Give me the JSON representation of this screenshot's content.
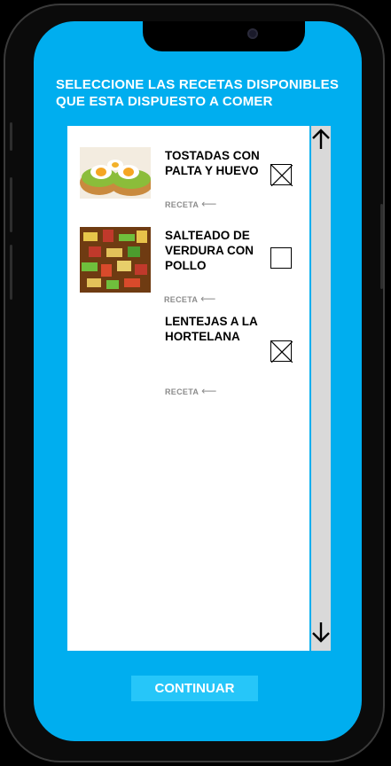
{
  "screen": {
    "heading": "SELECCIONE LAS RECETAS DISPONIBLES QUE ESTA DISPUESTO A COMER"
  },
  "recipes": [
    {
      "title": "TOSTADAS CON PALTA Y HUEVO",
      "link_label": "RECETA",
      "checked": true,
      "image": "avocado-egg-toast"
    },
    {
      "title": "SALTEADO DE VERDURA CON POLLO",
      "link_label": "RECETA",
      "checked": false,
      "image": "vegetable-chicken-stirfry"
    },
    {
      "title": "LENTEJAS A LA HORTELANA",
      "link_label": "RECETA",
      "checked": true,
      "image": ""
    }
  ],
  "scrollbar": {
    "up_icon": "arrow-up-icon",
    "down_icon": "arrow-down-icon"
  },
  "footer": {
    "continue_label": "CONTINUAR"
  },
  "colors": {
    "screen_bg": "#00AEEF",
    "button_bg": "#26C6F9",
    "scrollbar_bg": "#d9d9d9"
  }
}
